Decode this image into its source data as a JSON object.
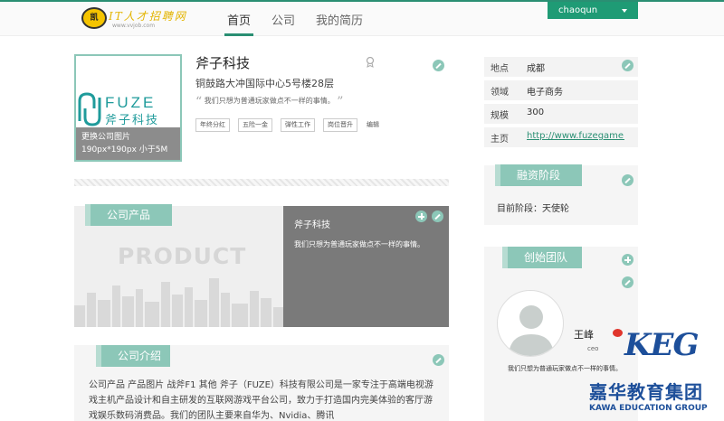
{
  "site": {
    "logo_badge": "凯",
    "logo_title": "IT人才招聘网",
    "logo_url": "www.vvjob.com"
  },
  "nav": {
    "items": [
      {
        "label": "首页",
        "active": true
      },
      {
        "label": "公司",
        "active": false
      },
      {
        "label": "我的简历",
        "active": false
      }
    ],
    "user": "chaoqun"
  },
  "company": {
    "name": "斧子科技",
    "address": "铜鼓路大冲国际中心5号楼28层",
    "slogan": "我们只想为普通玩家做点不一样的事情。",
    "quote_open": "“",
    "quote_close": "”",
    "tags": [
      "年终分红",
      "五险一金",
      "弹性工作",
      "岗位晋升"
    ],
    "tags_edit": "编辑",
    "logo_text_en": "FUZE",
    "logo_text_cn": "斧子科技",
    "logo_change": "更换公司图片",
    "logo_hint": "190px*190px 小于5M"
  },
  "product": {
    "section_label": "公司产品",
    "banner_word": "PRODUCT",
    "name": "斧子科技",
    "desc": "我们只想为普通玩家做点不一样的事情。"
  },
  "intro": {
    "section_label": "公司介绍",
    "text": "公司产品 产品图片 战斧F1 其他 斧子（FUZE）科技有限公司是一家专注于高端电视游戏主机产品设计和自主研发的互联网游戏平台公司，致力于打造国内完美体验的客厅游戏娱乐数码消费品。我们的团队主要来自华为、Nvidia、腾讯"
  },
  "info": [
    {
      "key": "地点",
      "value": "成都"
    },
    {
      "key": "领域",
      "value": "电子商务"
    },
    {
      "key": "规模",
      "value": "300"
    },
    {
      "key": "主页",
      "value": "http://www.fuzegame.com"
    }
  ],
  "funding": {
    "section_label": "融资阶段",
    "text": "目前阶段：天使轮"
  },
  "team": {
    "section_label": "创始团队",
    "name": "王峰",
    "title": "ceo",
    "desc": "我们只想为普通玩家做点不一样的事情。"
  },
  "watermark": {
    "logo": "KEG",
    "cn": "嘉华教育集团",
    "en": "KAWA EDUCATION GROUP"
  },
  "colors": {
    "accent": "#2a8f73",
    "label_bg": "#8cc7b8",
    "dropdown": "#1f9b75"
  }
}
